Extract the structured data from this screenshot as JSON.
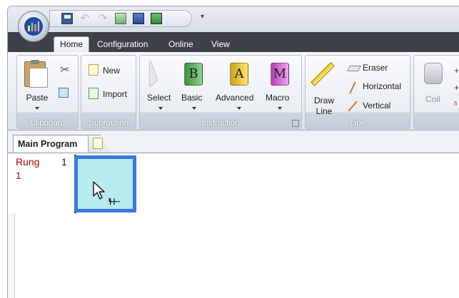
{
  "menu_tabs": [
    "Home",
    "Configuration",
    "Online",
    "View"
  ],
  "ribbon": {
    "clipboard": {
      "paste": "Paste",
      "group": "Clipboard"
    },
    "subroutine": {
      "new": "New",
      "import": "Import",
      "group": "Subroutine"
    },
    "instruction": {
      "select": "Select",
      "basic": "Basic",
      "advanced": "Advanced",
      "macro": "Macro",
      "group": "Instruction",
      "book_b": "B",
      "book_a": "A",
      "book_m": "M"
    },
    "line": {
      "draw_line_1": "Draw",
      "draw_line_2": "Line",
      "eraser": "Eraser",
      "horizontal": "Horizontal",
      "vertical": "Vertical",
      "group": "Line"
    },
    "coil": {
      "label": "Coil"
    }
  },
  "document": {
    "tab_label": "Main Program",
    "rung_label": "Rung",
    "rung_label_number": "1",
    "rung_index": "1"
  },
  "colors": {
    "tab_bar": "#3e4148",
    "rung_text": "#c00000",
    "cell_border": "#3a78e0",
    "cell_fill": "#b6ecef"
  }
}
